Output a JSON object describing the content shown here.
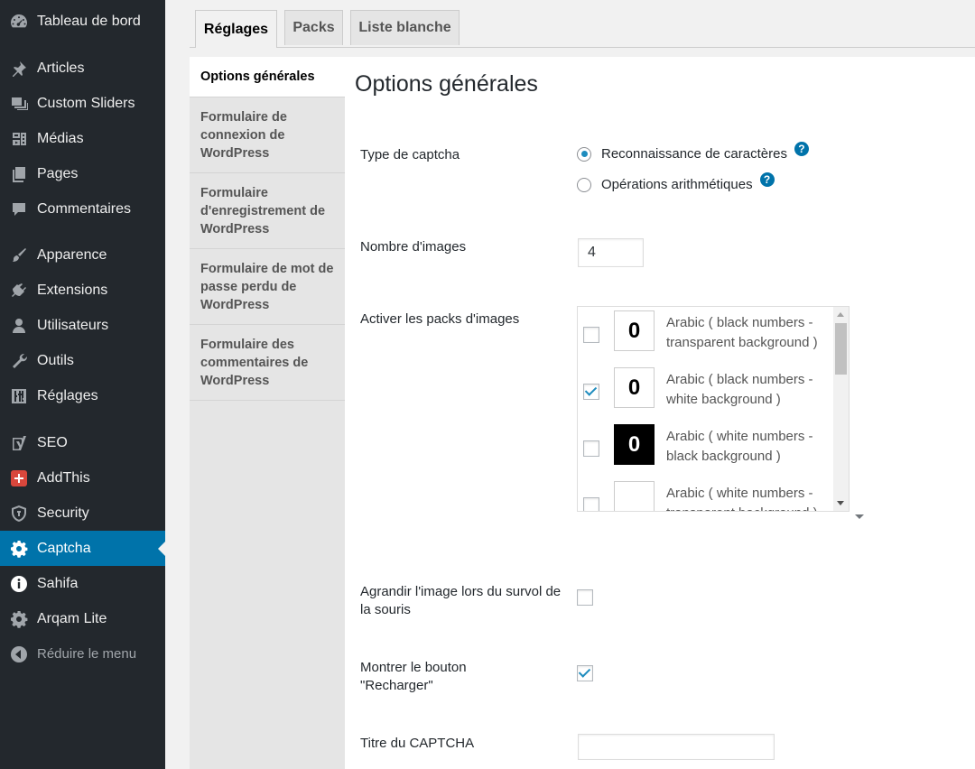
{
  "sidebar": {
    "items": [
      {
        "label": "Tableau de bord",
        "icon": "dashboard-icon"
      },
      {
        "label": "Articles",
        "icon": "pushpin-icon"
      },
      {
        "label": "Custom Sliders",
        "icon": "slides-icon"
      },
      {
        "label": "Médias",
        "icon": "media-icon"
      },
      {
        "label": "Pages",
        "icon": "pages-icon"
      },
      {
        "label": "Commentaires",
        "icon": "comment-icon"
      },
      {
        "label": "Apparence",
        "icon": "paintbrush-icon"
      },
      {
        "label": "Extensions",
        "icon": "plugin-icon"
      },
      {
        "label": "Utilisateurs",
        "icon": "users-icon"
      },
      {
        "label": "Outils",
        "icon": "wrench-icon"
      },
      {
        "label": "Réglages",
        "icon": "settings-sliders-icon"
      },
      {
        "label": "SEO",
        "icon": "yoast-seo-icon"
      },
      {
        "label": "AddThis",
        "icon": "addthis-plus-icon"
      },
      {
        "label": "Security",
        "icon": "shield-icon"
      },
      {
        "label": "Captcha",
        "icon": "gear-icon"
      },
      {
        "label": "Sahifa",
        "icon": "info-icon"
      },
      {
        "label": "Arqam Lite",
        "icon": "gear-icon"
      },
      {
        "label": "Réduire le menu",
        "icon": "collapse-arrow-icon"
      }
    ],
    "current": "Captcha"
  },
  "tabs": [
    {
      "label": "Réglages",
      "active": true
    },
    {
      "label": "Packs",
      "active": false
    },
    {
      "label": "Liste blanche",
      "active": false
    }
  ],
  "subnav": [
    {
      "label": "Options générales",
      "active": true
    },
    {
      "label": "Formulaire de connexion de WordPress",
      "active": false
    },
    {
      "label": "Formulaire d'enregistrement de WordPress",
      "active": false
    },
    {
      "label": "Formulaire de mot de passe perdu de WordPress",
      "active": false
    },
    {
      "label": "Formulaire des commentaires de WordPress",
      "active": false
    }
  ],
  "main": {
    "title": "Options générales",
    "captcha_type": {
      "label": "Type de captcha",
      "options": [
        {
          "label": "Reconnaissance de caractères",
          "checked": true
        },
        {
          "label": "Opérations arithmétiques",
          "checked": false
        }
      ],
      "help_glyph": "?"
    },
    "image_count": {
      "label": "Nombre d'images",
      "value": "4"
    },
    "packs": {
      "label": "Activer les packs d'images",
      "items": [
        {
          "thumb": "0",
          "style": "light",
          "label": "Arabic ( black numbers - transparent background )",
          "checked": false
        },
        {
          "thumb": "0",
          "style": "light",
          "label": "Arabic ( black numbers - white background )",
          "checked": true
        },
        {
          "thumb": "0",
          "style": "dark",
          "label": "Arabic ( white numbers - black background )",
          "checked": false
        },
        {
          "thumb": "",
          "style": "light",
          "label": "Arabic ( white numbers - transparent background )",
          "checked": false
        }
      ]
    },
    "enlarge_on_hover": {
      "label": "Agrandir l'image lors du survol de la souris",
      "checked": false
    },
    "show_reload": {
      "label": "Montrer le bouton \"Recharger\"",
      "checked": true
    },
    "captcha_title": {
      "label": "Titre du CAPTCHA",
      "value": ""
    }
  },
  "colors": {
    "sidebar_bg": "#23282d",
    "accent": "#0073aa",
    "checkbox_check": "#1e8cbe"
  }
}
